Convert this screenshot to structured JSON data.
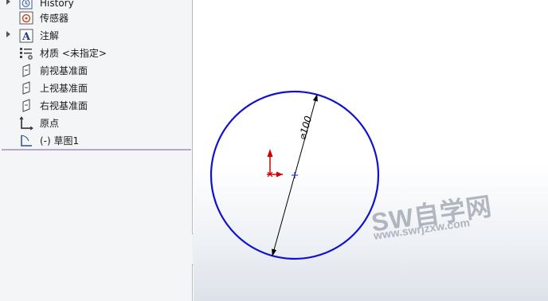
{
  "feature_tree": {
    "items": [
      {
        "label": "History",
        "icon": "history-icon",
        "expandable": true
      },
      {
        "label": "传感器",
        "icon": "sensor-icon",
        "expandable": false
      },
      {
        "label": "注解",
        "icon": "annotation-icon",
        "expandable": true
      },
      {
        "label": "材质 <未指定>",
        "icon": "material-icon",
        "expandable": false
      },
      {
        "label": "前视基准面",
        "icon": "plane-icon",
        "expandable": false
      },
      {
        "label": "上视基准面",
        "icon": "plane-icon",
        "expandable": false
      },
      {
        "label": "右视基准面",
        "icon": "plane-icon",
        "expandable": false
      },
      {
        "label": "原点",
        "icon": "origin-icon",
        "expandable": false
      },
      {
        "label": "(-) 草图1",
        "icon": "sketch-icon",
        "expandable": false
      }
    ]
  },
  "viewport": {
    "dimension_text": "⌀100",
    "watermark": "SW自学网",
    "watermark_url": "www.swrjzxw.com",
    "sketch_color": "#1010d0",
    "origin_color": "#d00000"
  }
}
